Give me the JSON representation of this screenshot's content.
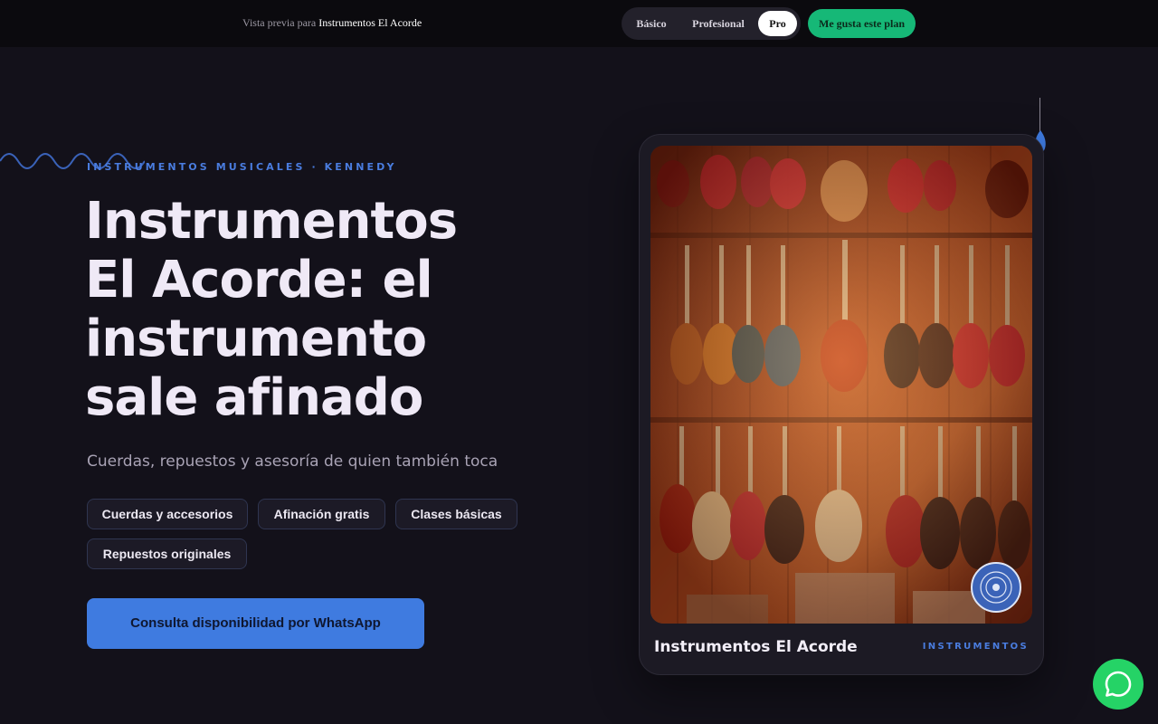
{
  "topbar": {
    "preview_prefix": "Vista previa para",
    "business_name": "Instrumentos El Acorde",
    "plans": [
      "Básico",
      "Profesional",
      "Pro"
    ],
    "selected_plan": "Pro",
    "like_button": "Me gusta este plan"
  },
  "hero": {
    "eyebrow": "INSTRUMENTOS MUSICALES · KENNEDY",
    "headline": "Instrumentos El Acorde: el instrumento sale afinado",
    "subtitle": "Cuerdas, repuestos y asesoría de quien también toca",
    "chips": [
      "Cuerdas y accesorios",
      "Afinación gratis",
      "Clases básicas",
      "Repuestos originales"
    ],
    "cta": "Consulta disponibilidad por WhatsApp"
  },
  "card": {
    "title": "Instrumentos El Acorde",
    "tag": "INSTRUMENTOS",
    "photo_icon": "guitar-wall-photo",
    "action_icon": "vinyl-disc-icon"
  },
  "floating": {
    "icon": "whatsapp-icon"
  },
  "colors": {
    "background": "#13111a",
    "accent": "#3f7be0",
    "like_green": "#16b877",
    "whatsapp": "#25d366"
  }
}
